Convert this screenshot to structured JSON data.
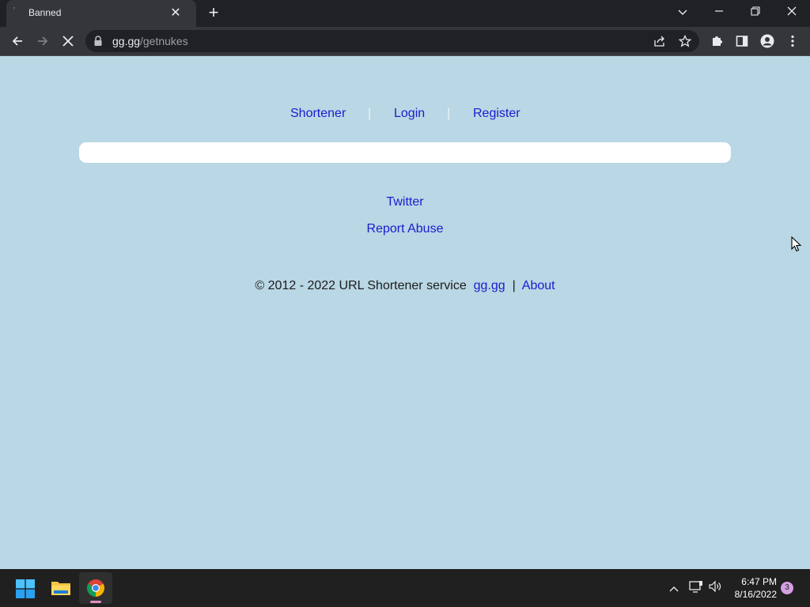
{
  "browser": {
    "tab": {
      "title": "Banned"
    },
    "address": {
      "host": "gg.gg",
      "path": "/getnukes"
    }
  },
  "page": {
    "nav": {
      "shortener": "Shortener",
      "login": "Login",
      "register": "Register",
      "separator": "|"
    },
    "links": {
      "twitter": "Twitter",
      "report_abuse": "Report Abuse"
    },
    "footer": {
      "copyright": "© 2012 - 2022 URL Shortener service",
      "site_link": "gg.gg",
      "divider": "|",
      "about": "About"
    }
  },
  "taskbar": {
    "clock": {
      "time": "6:47 PM",
      "date": "8/16/2022"
    },
    "notification_count": "3"
  },
  "colors": {
    "page_bg": "#b9d7e4",
    "link": "#1a1bd0",
    "chrome_dark": "#202124"
  }
}
